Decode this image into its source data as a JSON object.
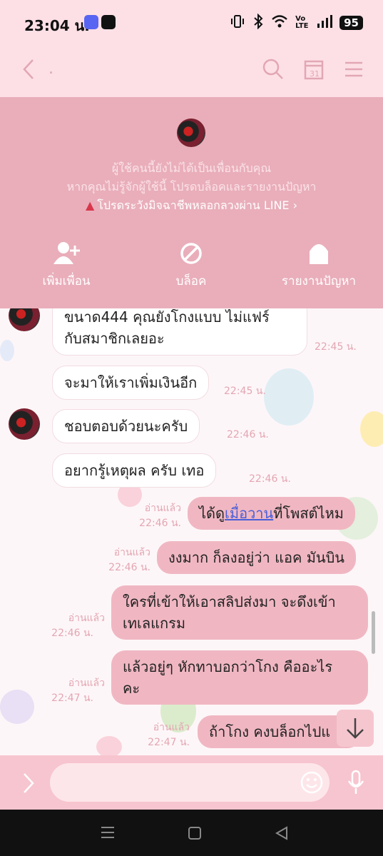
{
  "status_bar": {
    "time": "23:04 น.",
    "battery": "95",
    "network": "Vo LTE"
  },
  "header": {
    "title": "."
  },
  "stranger_panel": {
    "line1": "ผู้ใช้คนนี้ยังไม่ได้เป็นเพื่อนกับคุณ",
    "line2": "หากคุณไม่รู้จักผู้ใช้นี้ โปรดบล็อคและรายงานปัญหา",
    "warning": "โปรดระวังมิจฉาชีพหลอกลวงผ่าน LINE",
    "actions": [
      {
        "label": "เพิ่มเพื่อน",
        "icon": "add-friend-icon"
      },
      {
        "label": "บล็อค",
        "icon": "block-icon"
      },
      {
        "label": "รายงานปัญหา",
        "icon": "report-icon"
      }
    ]
  },
  "messages": {
    "m1": {
      "text_line1": "ขนาด444 คุณยังโกงแบบ  ไม่แฟร์",
      "text_line2": "กับสมาชิกเลยอะ",
      "time": "22:45 น."
    },
    "m2": {
      "text": "จะมาให้เราเพิ่มเงินอีก",
      "time": "22:45 น."
    },
    "m3": {
      "text": "ชอบตอบด้วยนะครับ",
      "time": "22:46 น."
    },
    "m4": {
      "text": "อยากรู้เหตุผล  ครับ เทอ",
      "time": "22:46 น."
    },
    "m5": {
      "pre": "ได้ดู",
      "link": "เมื่อวาน",
      "post": "ที่โพสต์ไหม",
      "read": "อ่านแล้ว",
      "time": "22:46 น."
    },
    "m6": {
      "text": "งงมาก ก็ลงอยู่ว่า แอค มันบิน",
      "read": "อ่านแล้ว",
      "time": "22:46 น."
    },
    "m7": {
      "text_line1": "ใครที่เข้าให้เอาสลิปส่งมา จะดึงเข้า",
      "text_line2": "เทเลแกรม",
      "read": "อ่านแล้ว",
      "time": "22:46 น."
    },
    "m8": {
      "text_line1": "แล้วอยู่ๆ หักทาบอกว่าโกง คืออะไร",
      "text_line2": "คะ",
      "read": "อ่านแล้ว",
      "time": "22:47 น."
    },
    "m9": {
      "text": "ถ้าโกง คงบล็อกไปแ",
      "read": "อ่านแล้ว",
      "time": "22:47 น."
    }
  },
  "colors": {
    "header_bg": "#fde0e6",
    "panel_bg": "#e9aeba",
    "outgoing_bubble": "#f0b7c2",
    "incoming_bubble": "#ffffff",
    "warning": "#d8374b"
  }
}
